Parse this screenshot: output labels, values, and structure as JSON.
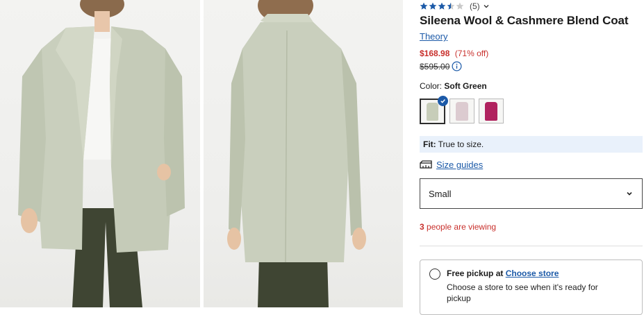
{
  "product": {
    "title": "Sileena Wool & Cashmere Blend Coat",
    "brand": "Theory",
    "rating": 3.5,
    "rating_max": 5,
    "review_count": "(5)",
    "sale_price": "$168.98",
    "discount": "(71% off)",
    "original_price": "$595.00"
  },
  "color": {
    "label": "Color:",
    "selected": "Soft Green",
    "swatches": [
      {
        "name": "soft-green",
        "color": "#c7cdb9",
        "selected": true
      },
      {
        "name": "light-pink",
        "color": "#dccbd0",
        "selected": false
      },
      {
        "name": "magenta",
        "color": "#b0225e",
        "selected": false
      }
    ]
  },
  "fit": {
    "label": "Fit:",
    "value": "True to size."
  },
  "size_guide": {
    "label": "Size guides"
  },
  "size_select": {
    "value": "Small"
  },
  "viewing": {
    "count": "3",
    "text": "people are viewing"
  },
  "pickup": {
    "title": "Free pickup at",
    "link": "Choose store",
    "description": "Choose a store to see when it's ready for pickup"
  },
  "images": [
    {
      "view": "front",
      "coat_color": "#c9cfbd"
    },
    {
      "view": "back",
      "coat_color": "#c9cfbd"
    }
  ],
  "colors": {
    "link": "#1c5aa8",
    "sale": "#c8302c",
    "star": "#1c5aa8",
    "fit_bg": "#e9f1fb"
  },
  "icons": [
    "star-icon",
    "chevron-down-icon",
    "info-icon",
    "check-icon",
    "ruler-icon"
  ]
}
